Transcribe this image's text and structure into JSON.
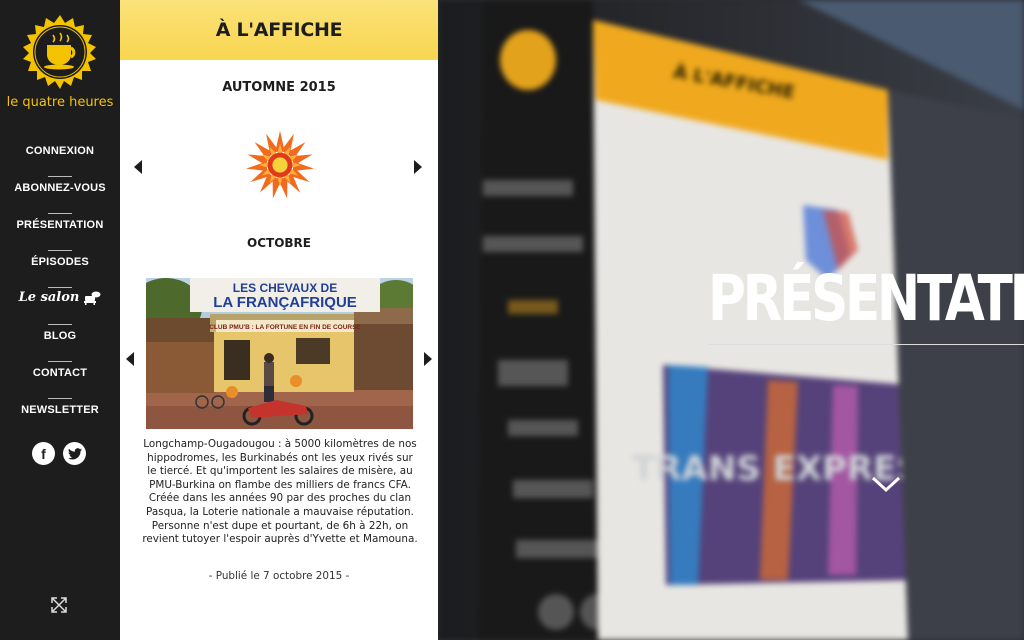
{
  "brand": {
    "name": "le quatre heures"
  },
  "nav": [
    {
      "label": "CONNEXION"
    },
    {
      "label": "ABONNEZ-VOUS"
    },
    {
      "label": "PRÉSENTATION"
    },
    {
      "label": "ÉPISODES"
    },
    {
      "label": "Le salon"
    },
    {
      "label": "BLOG"
    },
    {
      "label": "CONTACT"
    },
    {
      "label": "NEWSLETTER"
    }
  ],
  "social": {
    "facebook": "f",
    "twitter": "t"
  },
  "icons": {
    "logo": "coffee-cup-icon",
    "salon": "armchair-icon",
    "expand": "expand-arrows-icon",
    "prev": "triangle-left-icon",
    "next": "triangle-right-icon",
    "scroll": "chevron-down-icon"
  },
  "colors": {
    "accent": "#f4c300",
    "sidebar": "#1d1d1d",
    "header": "#f8d64f",
    "flower": "#f26b1d"
  },
  "affiche": {
    "title": "À L'AFFICHE",
    "season": "AUTOMNE 2015",
    "month": "OCTOBRE",
    "photo_sign_top": "LES CHEVAUX DE LA FRANÇAFRIQUE",
    "photo_sign_bottom": "CLUB PMU'B : LA FORTUNE EN FIN DE COURSE",
    "text": "Longchamp-Ougadougou : à 5000 kilomètres de nos hippodromes, les Burkinabés ont les yeux rivés sur le tiercé. Et qu'importent les salaires de misère, au PMU-Burkina on flambe des milliers de francs CFA. Créée dans les années 90 par des proches du clan Pasqua, la Loterie nationale a mauvaise réputation. Personne n'est dupe et pourtant, de 6h à 22h, on revient tutoyer l'espoir auprès d'Yvette et Mamouna.",
    "published": "- Publié le 7 octobre 2015 -"
  },
  "hero": {
    "title": "PRÉSENTATIO",
    "background_words": [
      "À L'AFFICHE",
      "TRANS EXPRESS"
    ]
  }
}
